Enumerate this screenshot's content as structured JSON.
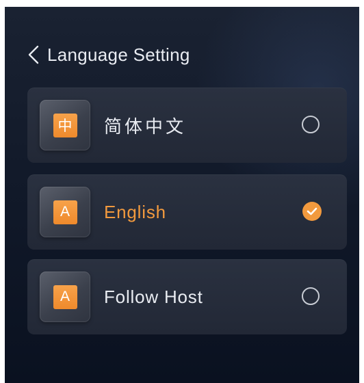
{
  "header": {
    "back_icon": "chevron-left-icon",
    "title": "Language Setting"
  },
  "options": [
    {
      "badge": "中",
      "label": "简体中文",
      "selected": false,
      "radio_icon": "radio-unchecked-icon"
    },
    {
      "badge": "A",
      "label": "English",
      "selected": true,
      "radio_icon": "radio-checked-icon"
    },
    {
      "badge": "A",
      "label": "Follow Host",
      "selected": false,
      "radio_icon": "radio-unchecked-icon"
    }
  ],
  "colors": {
    "accent": "#f29a3e",
    "text": "#e9ecf2",
    "card": "#262c3a",
    "background": "#101828"
  }
}
